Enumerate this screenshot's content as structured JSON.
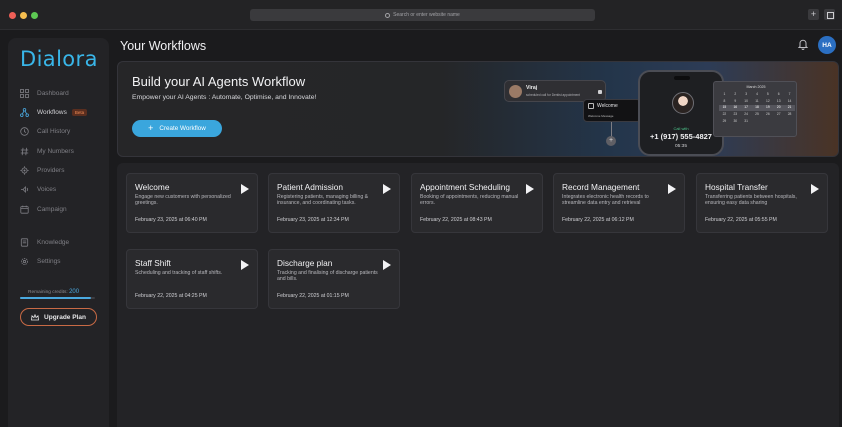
{
  "browser": {
    "address_placeholder": "Search or enter website name"
  },
  "sidebar": {
    "logo": "Dialora",
    "items": [
      {
        "label": "Dashboard",
        "icon": "dashboard-icon"
      },
      {
        "label": "Workflows",
        "icon": "workflow-icon",
        "badge": "Beta",
        "active": true
      },
      {
        "label": "Call History",
        "icon": "clock-icon"
      },
      {
        "label": "My Numbers",
        "icon": "hash-icon"
      },
      {
        "label": "Providers",
        "icon": "gear-icon"
      },
      {
        "label": "Voices",
        "icon": "voice-icon"
      },
      {
        "label": "Campaign",
        "icon": "calendar-icon"
      },
      {
        "label": "Knowledge",
        "icon": "book-icon"
      },
      {
        "label": "Settings",
        "icon": "settings-icon"
      }
    ],
    "credits_label": "Remaining credits:",
    "credits_value": "200",
    "credits_fraction": 0.95,
    "upgrade_label": "Upgrade Plan"
  },
  "header": {
    "title": "Your Workflows",
    "avatar_initials": "HA"
  },
  "hero": {
    "title": "Build your AI Agents Workflow",
    "subtitle": "Empower your AI Agents : Automate, Optimise, and Innovate!",
    "cta": "Create Workflow",
    "caller_name": "Viraj",
    "caller_desc": "scheduled call for Dentist appointment",
    "wf_card_title": "Welcome",
    "wf_card_tag": "Welcome Message",
    "phone_status": "Call with",
    "phone_number": "+1 (917) 555-4827",
    "phone_time": "05:35",
    "calendar_title": "March 2025",
    "calendar_days": [
      "1",
      "2",
      "3",
      "4",
      "5",
      "6",
      "7",
      "8",
      "9",
      "10",
      "11",
      "12",
      "13",
      "14",
      "15",
      "16",
      "17",
      "18",
      "19",
      "20",
      "21",
      "22",
      "23",
      "24",
      "25",
      "26",
      "27",
      "28",
      "29",
      "30",
      "31"
    ]
  },
  "workflows": [
    {
      "title": "Welcome",
      "desc": "Engage new customers with personalized greetings.",
      "date": "February 23, 2025 at 06:40 PM"
    },
    {
      "title": "Patient Admission",
      "desc": "Registering patients, managing billing & insurance, and coordinating tasks.",
      "date": "February 23, 2025 at 12:34 PM"
    },
    {
      "title": "Appointment Scheduling",
      "desc": "Booking of appointments, reducing manual errors.",
      "date": "February 22, 2025 at 08:43 PM"
    },
    {
      "title": "Record Management",
      "desc": "Integrates electronic health records to streamline data entry and retrieval",
      "date": "February 22, 2025 at 06:12 PM"
    },
    {
      "title": "Hospital Transfer",
      "desc": "Transferring patients between hospitals, ensuring easy data sharing",
      "date": "February 22, 2025 at 05:55 PM"
    },
    {
      "title": "Staff Shift",
      "desc": "Scheduling and tracking of staff shifts.",
      "date": "February 22, 2025 at 04:25 PM"
    },
    {
      "title": "Discharge plan",
      "desc": "Tracking and finalising of discharge patients and bills.",
      "date": "February 22, 2025 at 01:15 PM"
    }
  ]
}
